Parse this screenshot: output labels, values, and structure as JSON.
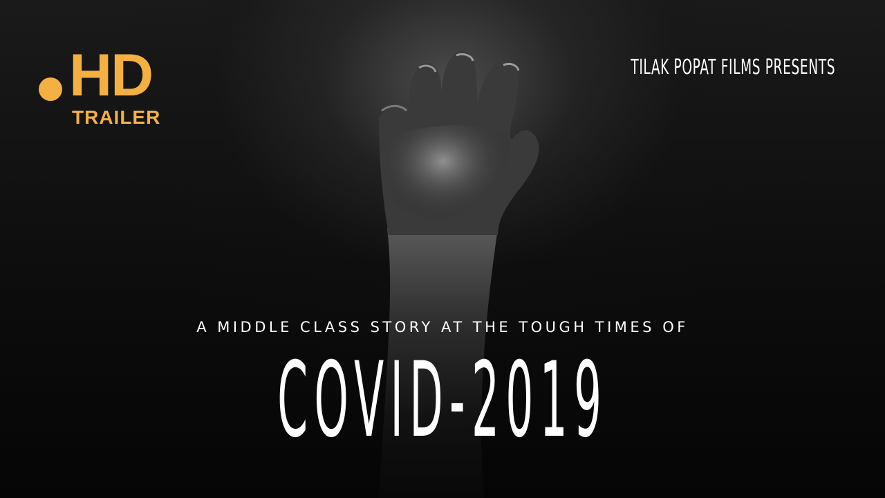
{
  "badge": {
    "hd": "HD",
    "trailer": "TRAILER",
    "accent_color": "#f4b043"
  },
  "presenter": "TILAK POPAT FILMS PRESENTS",
  "tagline": "A MIDDLE CLASS STORY AT THE TOUGH TIMES OF",
  "title": "COVID-2019",
  "image": {
    "subject": "hand-reaching-upward"
  }
}
